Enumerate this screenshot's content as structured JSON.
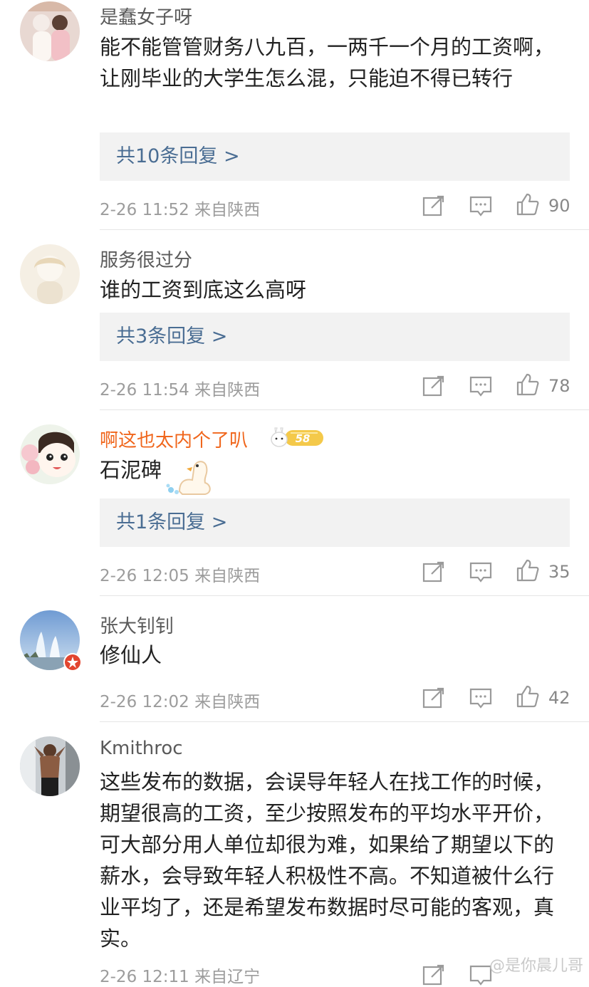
{
  "comments": [
    {
      "username": "是蠢女子呀",
      "text": "能不能管管财务八九百，一两千一个月的工资啊，让刚毕业的大学生怎么混，只能迫不得已转行",
      "replies": "共10条回复 >",
      "meta": "2-26 11:52  来自陕西",
      "likes": "90"
    },
    {
      "username": "服务很过分",
      "text": "谁的工资到底这么高呀",
      "replies": "共3条回复 >",
      "meta": "2-26 11:54  来自陕西",
      "likes": "78"
    },
    {
      "username": "啊这也太内个了叭",
      "badge": "58",
      "text": "石泥碑",
      "replies": "共1条回复 >",
      "meta": "2-26 12:05  来自陕西",
      "likes": "35"
    },
    {
      "username": "张大钊钊",
      "text": "修仙人",
      "meta": "2-26 12:02  来自陕西",
      "likes": "42"
    },
    {
      "username": "Kmithroc",
      "text": "这些发布的数据，会误导年轻人在找工作的时候，期望很高的工资，至少按照发布的平均水平开价，可大部分用人单位却很为难，如果给了期望以下的薪水，会导致年轻人积极性不高。不知道被什么行业平均了，还是希望发布数据时尽可能的客观，真实。",
      "meta": "2-26 12:11  来自辽宁"
    }
  ],
  "watermark": "@是你晨儿哥",
  "colors": {
    "reply_link": "#4a6d93",
    "name_highlight": "#f0661c",
    "reply_bg": "#f2f2f2"
  }
}
